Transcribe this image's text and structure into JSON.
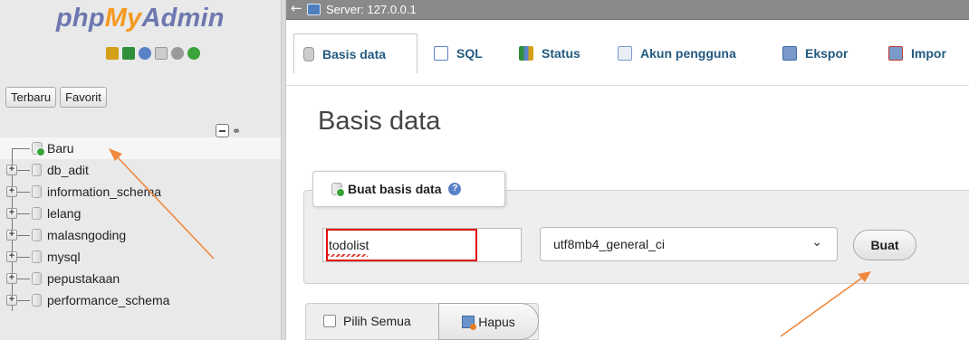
{
  "logo": {
    "php": "php",
    "my": "My",
    "admin": "Admin"
  },
  "nav": {
    "quick_icons": [
      "home-icon",
      "logout-icon",
      "help-icon",
      "docs-icon",
      "settings-icon",
      "reload-icon"
    ],
    "buttons": {
      "recent": "Terbaru",
      "favorite": "Favorit"
    },
    "tree": [
      "Baru",
      "db_adit",
      "information_schema",
      "lelang",
      "malasngoding",
      "mysql",
      "pepustakaan",
      "performance_schema"
    ]
  },
  "topbar": {
    "server": "Server: 127.0.0.1"
  },
  "menu": [
    {
      "label": "Basis data",
      "icon": "database-icon"
    },
    {
      "label": "SQL",
      "icon": "sql-icon"
    },
    {
      "label": "Status",
      "icon": "status-icon"
    },
    {
      "label": "Akun pengguna",
      "icon": "user-accounts-icon"
    },
    {
      "label": "Ekspor",
      "icon": "export-icon"
    },
    {
      "label": "Impor",
      "icon": "import-icon"
    }
  ],
  "main": {
    "title": "Basis data",
    "create": {
      "legend": "Buat basis data",
      "db_name_value": "todolist",
      "collation_value": "utf8mb4_general_ci",
      "submit": "Buat"
    },
    "bottom": {
      "select_all": "Pilih Semua",
      "delete": "Hapus"
    }
  },
  "colors": {
    "accent": "#235a81",
    "highlight": "#e01010",
    "annotation_arrow": "#f0883e"
  }
}
